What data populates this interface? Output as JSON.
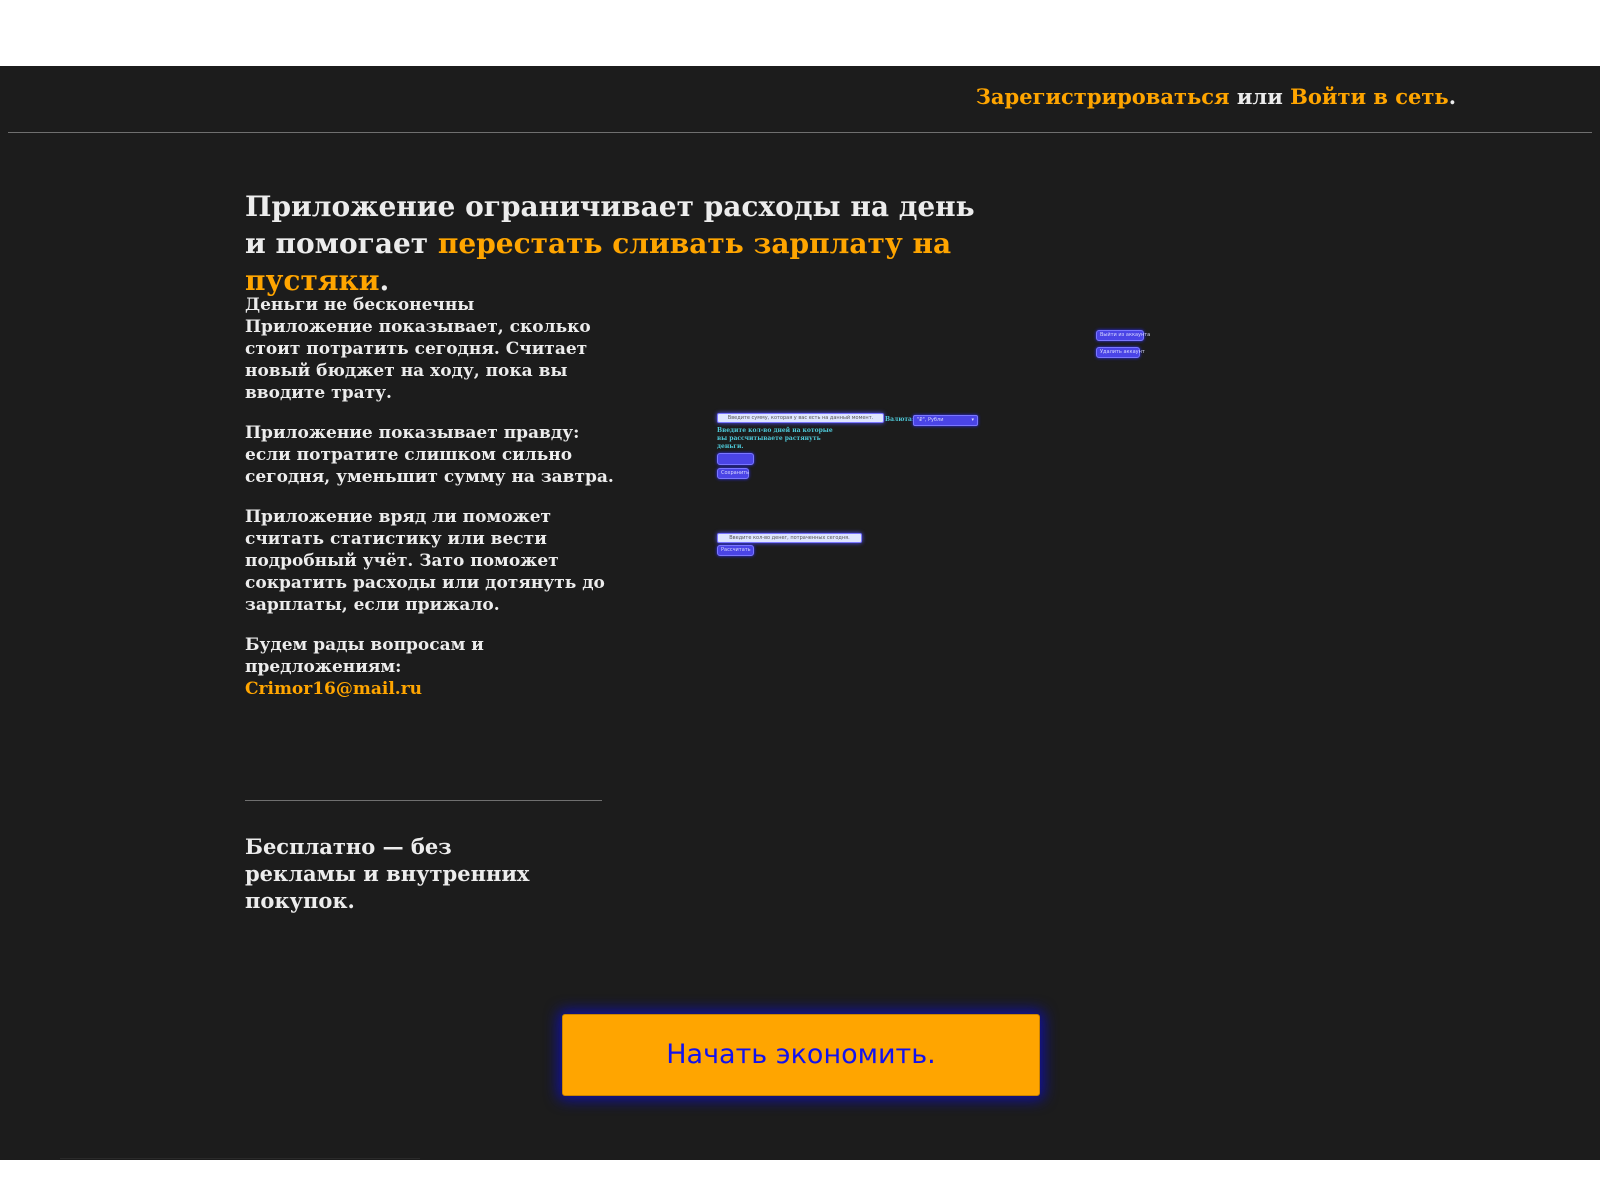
{
  "header": {
    "register_link": "Зарегистрироваться",
    "or_text": "или",
    "login_link": "Войти в сеть",
    "period": "."
  },
  "headline": {
    "part1": "Приложение ограничивает расходы на день и помогает ",
    "accent": "перестать сливать зарплату на пустяки",
    "period": "."
  },
  "features": {
    "block1_title": "Деньги не бесконечны",
    "block1_text": "Приложение показывает, сколько стоит потратить сегодня. Считает новый бюджет на ходу, пока вы вводите трату.",
    "block2_text": "Приложение показывает правду: если потратите слишком сильно сегодня, уменьшит сумму на завтра.",
    "block3_text": "Приложение вряд ли поможет считать статистику или вести подробный учёт. Зато поможет сократить расходы или дотянуть до зарплаты, если прижало.",
    "contact_text": "Будем рады вопросам и предложениям:",
    "email": "Crimor16@mail.ru"
  },
  "free_note": "Бесплатно — без рекламы и внутренних покупок.",
  "cta_label": "Начать экономить.",
  "preview": {
    "logout_button": "Выйти из аккаунта",
    "delete_account_button": "Удалить аккаунт",
    "amount_input_placeholder": "Введите сумму, которая у вас есть на данный момент.",
    "currency_label": "Валюта:",
    "currency_value": "\"₽\", Рубли",
    "days_label": "Введите кол-во дней на которые вы рассчитываете растянуть деньги.",
    "save_button": "Сохранить",
    "spent_input_placeholder": "Введите кол-во денег, потраченных сегодня.",
    "calculate_button": "Рассчитать"
  }
}
